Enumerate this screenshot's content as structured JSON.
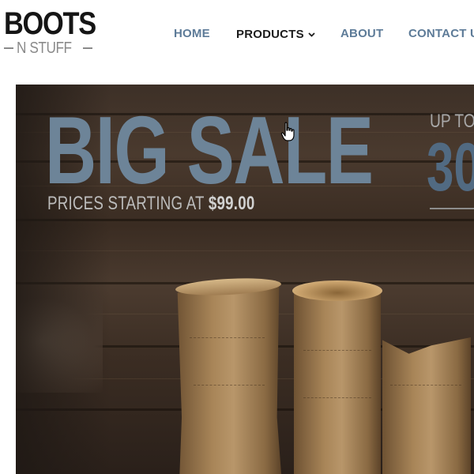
{
  "brand": {
    "name": "BOOTS",
    "tagline": "N STUFF"
  },
  "nav": {
    "items": [
      {
        "label": "HOME"
      },
      {
        "label": "PRODUCTS",
        "has_dropdown": true,
        "active": true
      },
      {
        "label": "ABOUT"
      },
      {
        "label": "CONTACT U"
      }
    ]
  },
  "hero": {
    "title": "BIG SALE",
    "subtitle_prefix": "PRICES STARTING AT ",
    "subtitle_price": "$99.00",
    "promo_upto": "UP TO",
    "promo_value": "30"
  },
  "colors": {
    "nav_text": "#5d7b98",
    "nav_active": "#1c1c1c",
    "title_blue": "#6d8498",
    "percent_blue": "#516a82"
  }
}
